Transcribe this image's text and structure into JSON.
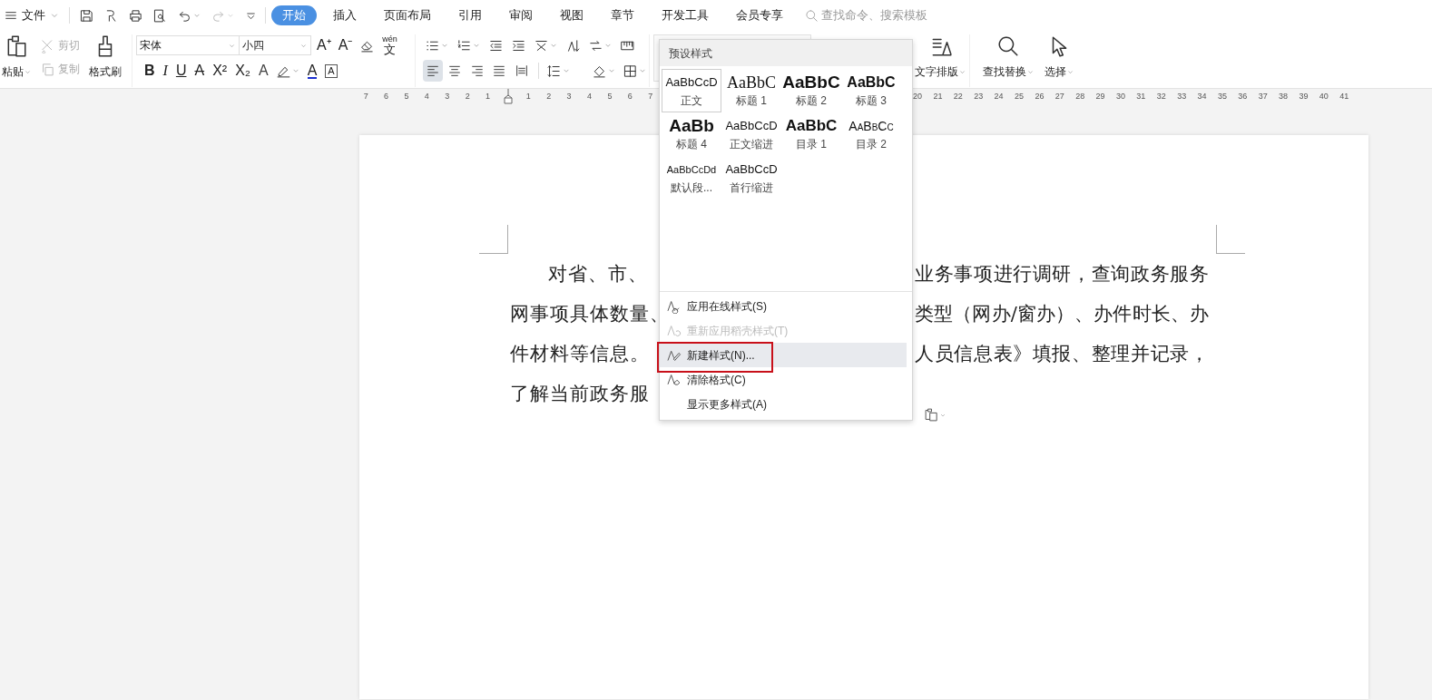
{
  "menu_bar": {
    "file_menu": "文件",
    "tabs": [
      {
        "label": "开始",
        "selected": true
      },
      {
        "label": "插入",
        "selected": false
      },
      {
        "label": "页面布局",
        "selected": false
      },
      {
        "label": "引用",
        "selected": false
      },
      {
        "label": "审阅",
        "selected": false
      },
      {
        "label": "视图",
        "selected": false
      },
      {
        "label": "章节",
        "selected": false
      },
      {
        "label": "开发工具",
        "selected": false
      },
      {
        "label": "会员专享",
        "selected": false
      }
    ],
    "search": {
      "placeholder": "查找命令、搜索模板"
    }
  },
  "ribbon": {
    "clipboard": {
      "paste": "粘贴",
      "cut": {
        "label": "剪切",
        "disabled": true
      },
      "copy": {
        "label": "复制",
        "disabled": true
      },
      "format_painter": "格式刷"
    },
    "font": {
      "name": "宋体",
      "size": "小四",
      "grow": "A⁺",
      "shrink": "A⁻",
      "phonetic": {
        "pinyin": "wén",
        "char": "文"
      },
      "format_buttons": [
        {
          "glyph": "B",
          "kind": "bold"
        },
        {
          "glyph": "I",
          "kind": "italic"
        },
        {
          "glyph": "U",
          "kind": "underline"
        },
        {
          "glyph": "A",
          "kind": "strike"
        },
        {
          "glyph": "X²",
          "kind": "plain"
        },
        {
          "glyph": "X₂",
          "kind": "plain"
        },
        {
          "glyph": "A",
          "kind": "outline"
        },
        {
          "glyph": "A",
          "kind": "color"
        },
        {
          "glyph": "A",
          "kind": "boxed"
        }
      ]
    },
    "paragraph": {
      "alignments": [
        {
          "selected": true
        },
        {
          "selected": false
        },
        {
          "selected": false
        },
        {
          "selected": false
        },
        {
          "selected": false
        }
      ]
    },
    "text_layout": "文字排版",
    "find_replace": "查找替换",
    "select": "选择"
  },
  "ruler": {
    "left_numbers": [
      "7",
      "6",
      "5",
      "4",
      "3",
      "2",
      "1"
    ],
    "right_numbers": [
      "1",
      "2",
      "3",
      "4",
      "5",
      "6",
      "7"
    ],
    "far_numbers": [
      "20",
      "21",
      "22",
      "23",
      "24",
      "25",
      "26",
      "27",
      "28",
      "29",
      "30",
      "31",
      "32",
      "33",
      "34",
      "35",
      "36",
      "37",
      "38",
      "39",
      "40",
      "41"
    ]
  },
  "style_menu": {
    "header": "预设样式",
    "styles": [
      {
        "preview": "AaBbCcD",
        "label": "正文",
        "kind": "body",
        "selected": true
      },
      {
        "preview": "AaBbC",
        "label": "标题 1",
        "kind": "heading1",
        "selected": false
      },
      {
        "preview": "AaBbC",
        "label": "标题 2",
        "kind": "heading2",
        "selected": false
      },
      {
        "preview": "AaBbC",
        "label": "标题 3",
        "kind": "heading3",
        "selected": false
      },
      {
        "preview": "AaBb",
        "label": "标题 4",
        "kind": "heading4",
        "selected": false
      },
      {
        "preview": "AaBbCcD",
        "label": "正文缩进",
        "kind": "body",
        "selected": false
      },
      {
        "preview": "AaBbC",
        "label": "目录 1",
        "kind": "toc1",
        "selected": false
      },
      {
        "preview": "AaBbCc",
        "label": "目录 2",
        "kind": "toc2",
        "selected": false
      },
      {
        "preview": "AaBbCcDd",
        "label": "默认段...",
        "kind": "small",
        "selected": false
      },
      {
        "preview": "AaBbCcD",
        "label": "首行缩进",
        "kind": "body",
        "selected": false
      }
    ],
    "actions": [
      {
        "label": "应用在线样式(S)",
        "icon": true,
        "disabled": false,
        "highlighted": false,
        "annotated": false
      },
      {
        "label": "重新应用稻壳样式(T)",
        "icon": true,
        "disabled": true,
        "highlighted": false,
        "annotated": false
      },
      {
        "label": "新建样式(N)...",
        "icon": true,
        "disabled": false,
        "highlighted": true,
        "annotated": true
      },
      {
        "label": "清除格式(C)",
        "icon": true,
        "disabled": false,
        "highlighted": false,
        "annotated": false
      },
      {
        "label": "显示更多样式(A)",
        "icon": false,
        "disabled": false,
        "highlighted": false,
        "annotated": false
      }
    ]
  },
  "document": {
    "lines": [
      {
        "left": "对省、市、",
        "right": "业务事项进行调研，查询政务服务",
        "indent": true
      },
      {
        "left": "网事项具体数量、",
        "right": "类型（网办/窗办）、办件时长、办",
        "indent": false
      },
      {
        "left": "件材料等信息。",
        "right": "人员信息表》填报、整理并记录，",
        "indent": false
      },
      {
        "left": "了解当前政务服",
        "indent": false
      }
    ]
  }
}
